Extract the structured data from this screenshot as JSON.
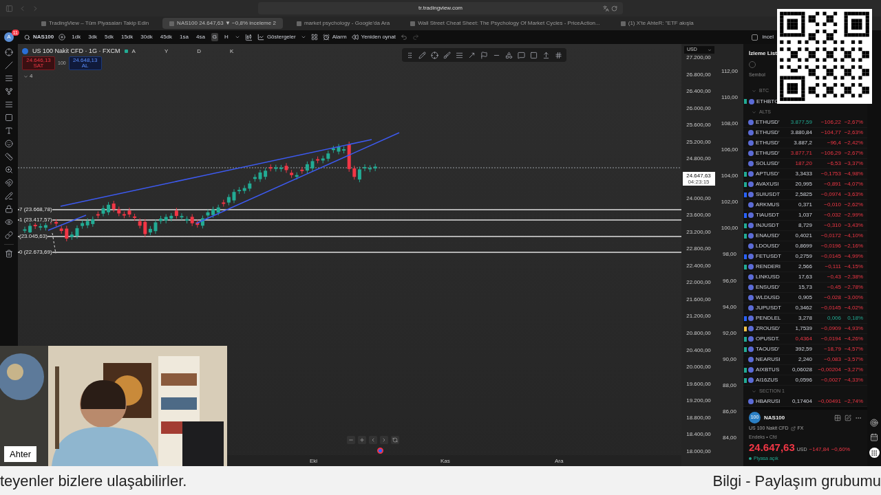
{
  "browser": {
    "url": "tr.tradingview.com",
    "tabs": [
      {
        "title": "TradingView – Tüm Piyasaları Takip Edin",
        "selected": false
      },
      {
        "title": "NAS100 24.647,63 ▼ −0,8% inceleme 2",
        "selected": true
      },
      {
        "title": "market psychology - Google'da Ara",
        "selected": false
      },
      {
        "title": "Wall Street Cheat Sheet: The Psychology Of Market Cycles - PriceAction...",
        "selected": false
      },
      {
        "title": "(1) X'te AhteR: \"ETF akışla",
        "selected": false
      }
    ]
  },
  "toolbar": {
    "avatar": "A",
    "badge": "11",
    "symbol": "NAS100",
    "intervals": [
      {
        "label": "1dk",
        "selected": false
      },
      {
        "label": "3dk",
        "selected": false
      },
      {
        "label": "5dk",
        "selected": false
      },
      {
        "label": "15dk",
        "selected": false
      },
      {
        "label": "30dk",
        "selected": false
      },
      {
        "label": "45dk",
        "selected": false
      },
      {
        "label": "1sa",
        "selected": false
      },
      {
        "label": "4sa",
        "selected": false
      },
      {
        "label": "G",
        "selected": true
      },
      {
        "label": "H",
        "selected": false
      }
    ],
    "indicators": "Göstergeler",
    "alarm": "Alarm",
    "replay": "Yeniden oynat",
    "checked": false,
    "right_label": "incel"
  },
  "chart": {
    "title": "US 100 Nakit CFD · 1G · FXCM",
    "ohlc_labels": [
      "A",
      "Y",
      "D",
      "K"
    ],
    "sell": {
      "price": "24.646,13",
      "label": "SAT"
    },
    "spread": "100",
    "buy": {
      "price": "24.648,13",
      "label": "AL"
    },
    "indicator_count": "4",
    "currency": "USD",
    "price_ticks": [
      "27.200,00",
      "26.800,00",
      "26.400,00",
      "26.000,00",
      "25.600,00",
      "25.200,00",
      "24.800,00",
      "24.000,00",
      "23.600,00",
      "23.200,00",
      "22.800,00",
      "22.400,00",
      "22.000,00",
      "21.600,00",
      "21.200,00",
      "20.800,00",
      "20.400,00",
      "20.000,00",
      "19.600,00",
      "19.200,00",
      "18.800,00",
      "18.400,00",
      "18.000,00"
    ],
    "percent_ticks": [
      "112,00",
      "110,00",
      "108,00",
      "106,00",
      "104,00",
      "102,00",
      "100,00",
      "98,00",
      "96,00",
      "94,00",
      "92,00",
      "90,00",
      "88,00",
      "86,00",
      "84,00"
    ],
    "last_price": "24.647,63",
    "countdown": "04:23:15",
    "fib_levels": [
      "7 (23.668,78)",
      "1 (23.417,57)",
      "(23.045,63)",
      "0 (22.673,69)"
    ],
    "time_labels": [
      "Eki",
      "Kas",
      "Ara"
    ]
  },
  "watchlist": {
    "title": "İzleme List",
    "column": "Sembol",
    "sections": [
      {
        "name": "BTC",
        "rows": [
          {
            "symbol": "ETHBTC",
            "color": "#22ab94"
          }
        ]
      },
      {
        "name": "ALTS",
        "rows": [
          {
            "symbol": "ETHUSD'",
            "last": "3.877,59",
            "change": "−106,22",
            "percent": "−2,67%",
            "price_up": true,
            "price_down": false,
            "change_up": false
          },
          {
            "symbol": "ETHUSD'",
            "last": "3.880,84",
            "change": "−104,77",
            "percent": "−2,63%",
            "price_up": false,
            "price_down": false,
            "change_up": false
          },
          {
            "symbol": "ETHUSD'",
            "last": "3.887,2",
            "change": "−96,4",
            "percent": "−2,42%",
            "price_up": false,
            "price_down": false,
            "change_up": false
          },
          {
            "symbol": "ETHUSD'",
            "last": "3.877,71",
            "change": "−106,29",
            "percent": "−2,67%",
            "price_up": false,
            "price_down": true,
            "change_up": false
          },
          {
            "symbol": "SOLUSD'",
            "last": "187,20",
            "change": "−6,53",
            "percent": "−3,37%",
            "price_up": false,
            "price_down": true,
            "change_up": false
          },
          {
            "symbol": "APTUSD'",
            "last": "3,3433",
            "change": "−0,1753",
            "percent": "−4,98%",
            "price_up": false,
            "price_down": false,
            "change_up": false,
            "color": "#22ab94"
          },
          {
            "symbol": "AVAXUSI",
            "last": "20,995",
            "change": "−0,891",
            "percent": "−4,07%",
            "price_up": false,
            "price_down": false,
            "change_up": false,
            "color": "#22ab94"
          },
          {
            "symbol": "SUIUSDT",
            "last": "2,5825",
            "change": "−0,0974",
            "percent": "−3,63%",
            "price_up": false,
            "price_down": false,
            "change_up": false,
            "color": "#2962ff"
          },
          {
            "symbol": "ARKMUS",
            "last": "0,371",
            "change": "−0,010",
            "percent": "−2,62%",
            "price_up": false,
            "price_down": false,
            "change_up": false
          },
          {
            "symbol": "TIAUSDT",
            "last": "1,037",
            "change": "−0,032",
            "percent": "−2,99%",
            "price_up": false,
            "price_down": false,
            "change_up": false,
            "color": "#2962ff"
          },
          {
            "symbol": "INJUSDT",
            "last": "8,729",
            "change": "−0,310",
            "percent": "−3,43%",
            "price_up": false,
            "price_down": false,
            "change_up": false,
            "color": "#22ab94"
          },
          {
            "symbol": "ENAUSD'",
            "last": "0,4021",
            "change": "−0,0172",
            "percent": "−4,10%",
            "price_up": false,
            "price_down": false,
            "change_up": false,
            "color": "#22ab94"
          },
          {
            "symbol": "LDOUSD'",
            "last": "0,8699",
            "change": "−0,0196",
            "percent": "−2,16%",
            "price_up": false,
            "price_down": false,
            "change_up": false
          },
          {
            "symbol": "FETUSDT",
            "last": "0,2759",
            "change": "−0,0145",
            "percent": "−4,99%",
            "price_up": false,
            "price_down": false,
            "change_up": false,
            "color": "#2962ff"
          },
          {
            "symbol": "RENDERI",
            "last": "2,566",
            "change": "−0,111",
            "percent": "−4,15%",
            "price_up": false,
            "price_down": false,
            "change_up": false,
            "color": "#22ab94"
          },
          {
            "symbol": "LINKUSD",
            "last": "17,63",
            "change": "−0,43",
            "percent": "−2,38%",
            "price_up": false,
            "price_down": false,
            "change_up": false
          },
          {
            "symbol": "ENSUSD'",
            "last": "15,73",
            "change": "−0,45",
            "percent": "−2,78%",
            "price_up": false,
            "price_down": false,
            "change_up": false
          },
          {
            "symbol": "WLDUSD",
            "last": "0,905",
            "change": "−0,028",
            "percent": "−3,00%",
            "price_up": false,
            "price_down": false,
            "change_up": false
          },
          {
            "symbol": "JUPUSDT",
            "last": "0,3462",
            "change": "−0,0145",
            "percent": "−4,02%",
            "price_up": false,
            "price_down": false,
            "change_up": false
          },
          {
            "symbol": "PENDLEL",
            "last": "3,278",
            "change": "0,006",
            "percent": "0,18%",
            "price_up": false,
            "price_down": false,
            "change_up": true,
            "color": "#2962ff"
          },
          {
            "symbol": "ZROUSD'",
            "last": "1,7539",
            "change": "−0,0909",
            "percent": "−4,93%",
            "price_up": false,
            "price_down": false,
            "change_up": false,
            "color": "#f7c548"
          },
          {
            "symbol": "OPUSDT.",
            "last": "0,4364",
            "change": "−0,0194",
            "percent": "−4,26%",
            "price_up": false,
            "price_down": true,
            "change_up": false,
            "color": "#22ab94"
          },
          {
            "symbol": "TAOUSD'",
            "last": "392,59",
            "change": "−18,79",
            "percent": "−4,57%",
            "price_up": false,
            "price_down": false,
            "change_up": false,
            "color": "#22ab94"
          },
          {
            "symbol": "NEARUSI",
            "last": "2,240",
            "change": "−0,083",
            "percent": "−3,57%",
            "price_up": false,
            "price_down": false,
            "change_up": false
          },
          {
            "symbol": "AIXBTUS",
            "last": "0,06028",
            "change": "−0,00204",
            "percent": "−3,27%",
            "price_up": false,
            "price_down": false,
            "change_up": false,
            "color": "#22ab94"
          },
          {
            "symbol": "AI16ZUS",
            "last": "0,0596",
            "change": "−0,0027",
            "percent": "−4,33%",
            "price_up": false,
            "price_down": false,
            "change_up": false,
            "color": "#22ab94"
          }
        ]
      },
      {
        "name": "SECTION 1",
        "rows": [
          {
            "symbol": "HBARUSI",
            "last": "0,17404",
            "change": "−0,00491",
            "percent": "−2,74%",
            "price_up": false,
            "price_down": false,
            "change_up": false
          }
        ]
      }
    ]
  },
  "details": {
    "logo": "100",
    "symbol": "NAS100",
    "name": "US 100 Nakit CFD",
    "market": "FX",
    "category": "Endeks • Cfd",
    "price": "24.647,63",
    "currency": "USD",
    "change": "−147,84",
    "percent": "−0,60%",
    "status": "Piyasa açık"
  },
  "webcam": {
    "name": "Ahter"
  },
  "ticker": [
    "teyenler bizlere ulaşabilirler.",
    "Bilgi - Paylaşım grubumu"
  ]
}
